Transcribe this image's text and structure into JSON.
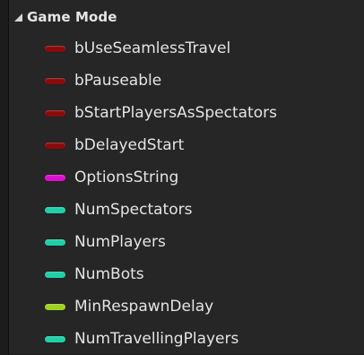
{
  "category": {
    "label": "Game Mode"
  },
  "variables": [
    {
      "name": "bUseSeamlessTravel",
      "type_color": "#8b0a0a",
      "type_icon": "bool-pill-icon"
    },
    {
      "name": "bPauseable",
      "type_color": "#8b0a0a",
      "type_icon": "bool-pill-icon"
    },
    {
      "name": "bStartPlayersAsSpectators",
      "type_color": "#8b0a0a",
      "type_icon": "bool-pill-icon"
    },
    {
      "name": "bDelayedStart",
      "type_color": "#8b0a0a",
      "type_icon": "bool-pill-icon"
    },
    {
      "name": "OptionsString",
      "type_color": "#e00fd0",
      "type_icon": "string-pill-icon"
    },
    {
      "name": "NumSpectators",
      "type_color": "#1ecfa8",
      "type_icon": "int-pill-icon"
    },
    {
      "name": "NumPlayers",
      "type_color": "#1ecfa8",
      "type_icon": "int-pill-icon"
    },
    {
      "name": "NumBots",
      "type_color": "#1ecfa8",
      "type_icon": "int-pill-icon"
    },
    {
      "name": "MinRespawnDelay",
      "type_color": "#9ed11f",
      "type_icon": "float-pill-icon"
    },
    {
      "name": "NumTravellingPlayers",
      "type_color": "#1ecfa8",
      "type_icon": "int-pill-icon"
    }
  ]
}
